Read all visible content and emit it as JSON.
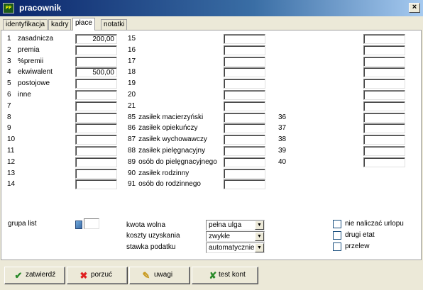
{
  "window": {
    "title": "pracownik",
    "icon": "app-icon",
    "close_label": "×"
  },
  "tabs": [
    {
      "label": "identyfikacja",
      "active": false
    },
    {
      "label": "kadry",
      "active": false
    },
    {
      "label": "płace",
      "active": true
    },
    {
      "label": "notatki",
      "active": false
    }
  ],
  "col1": [
    {
      "num": "1",
      "label": "zasadnicza",
      "value": "200,00"
    },
    {
      "num": "2",
      "label": "premia",
      "value": ""
    },
    {
      "num": "3",
      "label": "%premii",
      "value": ""
    },
    {
      "num": "4",
      "label": "ekwiwalent",
      "value": "500,00"
    },
    {
      "num": "5",
      "label": "postojowe",
      "value": ""
    },
    {
      "num": "6",
      "label": "inne",
      "value": ""
    },
    {
      "num": "7",
      "label": "",
      "value": ""
    },
    {
      "num": "8",
      "label": "",
      "value": ""
    },
    {
      "num": "9",
      "label": "",
      "value": ""
    },
    {
      "num": "10",
      "label": "",
      "value": ""
    },
    {
      "num": "11",
      "label": "",
      "value": ""
    },
    {
      "num": "12",
      "label": "",
      "value": ""
    },
    {
      "num": "13",
      "label": "",
      "value": ""
    },
    {
      "num": "14",
      "label": "",
      "value": ""
    }
  ],
  "col2": [
    {
      "num": "15",
      "label": "",
      "value": ""
    },
    {
      "num": "16",
      "label": "",
      "value": ""
    },
    {
      "num": "17",
      "label": "",
      "value": ""
    },
    {
      "num": "18",
      "label": "",
      "value": ""
    },
    {
      "num": "19",
      "label": "",
      "value": ""
    },
    {
      "num": "20",
      "label": "",
      "value": ""
    },
    {
      "num": "21",
      "label": "",
      "value": ""
    },
    {
      "num": "85",
      "label": "zasiłek macierzyński",
      "value": ""
    },
    {
      "num": "86",
      "label": "zasiłek opiekuńczy",
      "value": ""
    },
    {
      "num": "87",
      "label": "zasiłek wychowawczy",
      "value": ""
    },
    {
      "num": "88",
      "label": "zasiłek pielęgnacyjny",
      "value": ""
    },
    {
      "num": "89",
      "label": "osób do pielęgnacyjnego",
      "value": ""
    },
    {
      "num": "90",
      "label": "zasiłek rodzinny",
      "value": ""
    },
    {
      "num": "91",
      "label": "osób do rodzinnego",
      "value": ""
    }
  ],
  "col3": [
    {
      "num": "",
      "value": ""
    },
    {
      "num": "",
      "value": ""
    },
    {
      "num": "",
      "value": ""
    },
    {
      "num": "",
      "value": ""
    },
    {
      "num": "",
      "value": ""
    },
    {
      "num": "",
      "value": ""
    },
    {
      "num": "",
      "value": ""
    },
    {
      "num": "36",
      "value": ""
    },
    {
      "num": "37",
      "value": ""
    },
    {
      "num": "38",
      "value": ""
    },
    {
      "num": "39",
      "value": ""
    },
    {
      "num": "40",
      "value": ""
    }
  ],
  "grupa": {
    "label": "grupa list",
    "value": ""
  },
  "tax": {
    "kwota_label": "kwota wolna",
    "kwota_value": "pełna ulga",
    "koszty_label": "koszty uzyskania",
    "koszty_value": "zwykłe",
    "stawka_label": "stawka podatku",
    "stawka_value": "automatycznie"
  },
  "checks": [
    {
      "label": "nie naliczać urlopu",
      "checked": false
    },
    {
      "label": "drugi etat",
      "checked": false
    },
    {
      "label": "przelew",
      "checked": false
    }
  ],
  "buttons": {
    "confirm": "zatwierdź",
    "cancel": "porzuć",
    "notes": "uwagi",
    "test": "test kont"
  },
  "colors": {
    "title_start": "#0a246a",
    "title_end": "#a6caf0",
    "confirm_icon": "#2a8a2a",
    "cancel_icon": "#e02020"
  }
}
